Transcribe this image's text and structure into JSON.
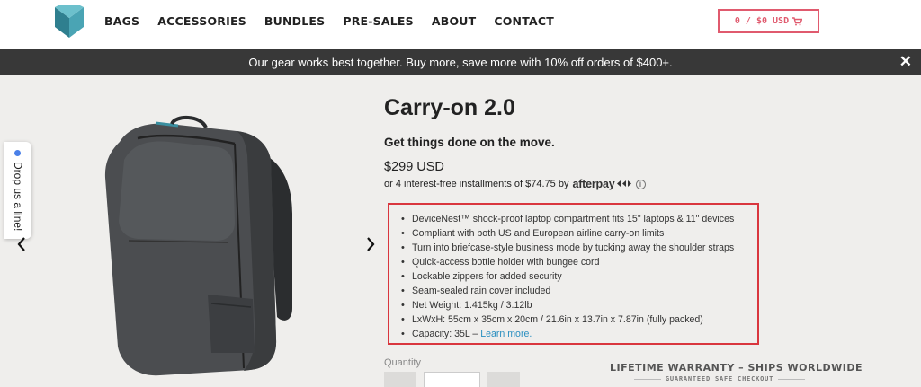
{
  "header": {
    "nav": [
      "BAGS",
      "ACCESSORIES",
      "BUNDLES",
      "PRE-SALES",
      "ABOUT",
      "CONTACT"
    ],
    "cart_label": "0 / $0 USD",
    "cart_icon": "cart-icon"
  },
  "banner": {
    "text": "Our gear works best together. Buy more, save more with 10% off orders of $400+.",
    "close": "✕"
  },
  "side_tab": {
    "label": "Drop us a line!"
  },
  "carousel": {
    "prev": "‹",
    "next": "›"
  },
  "product": {
    "title": "Carry-on 2.0",
    "subtitle": "Get things done on the move.",
    "price": "$299 USD",
    "installments_text": "or 4 interest-free installments of $74.75 by",
    "afterpay": "afterpay",
    "info_icon": "ⓘ",
    "features": [
      "DeviceNest™ shock-proof laptop compartment fits 15\" laptops & 11\" devices",
      "Compliant with both US and European airline carry-on limits",
      "Turn into briefcase-style business mode by tucking away the shoulder straps",
      "Quick-access bottle holder with bungee cord",
      "Lockable zippers for added security",
      "Seam-sealed rain cover included",
      "Net Weight: 1.415kg / 3.12lb",
      "LxWxH: 55cm x 35cm x 20cm / 21.6in x 13.7in x 7.87in (fully packed)"
    ],
    "capacity_text": "Capacity: 35L –",
    "learn_more": "Learn more."
  },
  "quantity": {
    "label": "Quantity"
  },
  "warranty": {
    "title": "LIFETIME WARRANTY – SHIPS WORLDWIDE",
    "safe_checkout": "GUARANTEED SAFE CHECKOUT"
  },
  "colors": {
    "accent_red": "#d9363e",
    "cart_pink": "#e05a6e",
    "link_blue": "#2a8fc0",
    "banner_bg": "#383838",
    "logo_teal": "#3a8fa0"
  }
}
